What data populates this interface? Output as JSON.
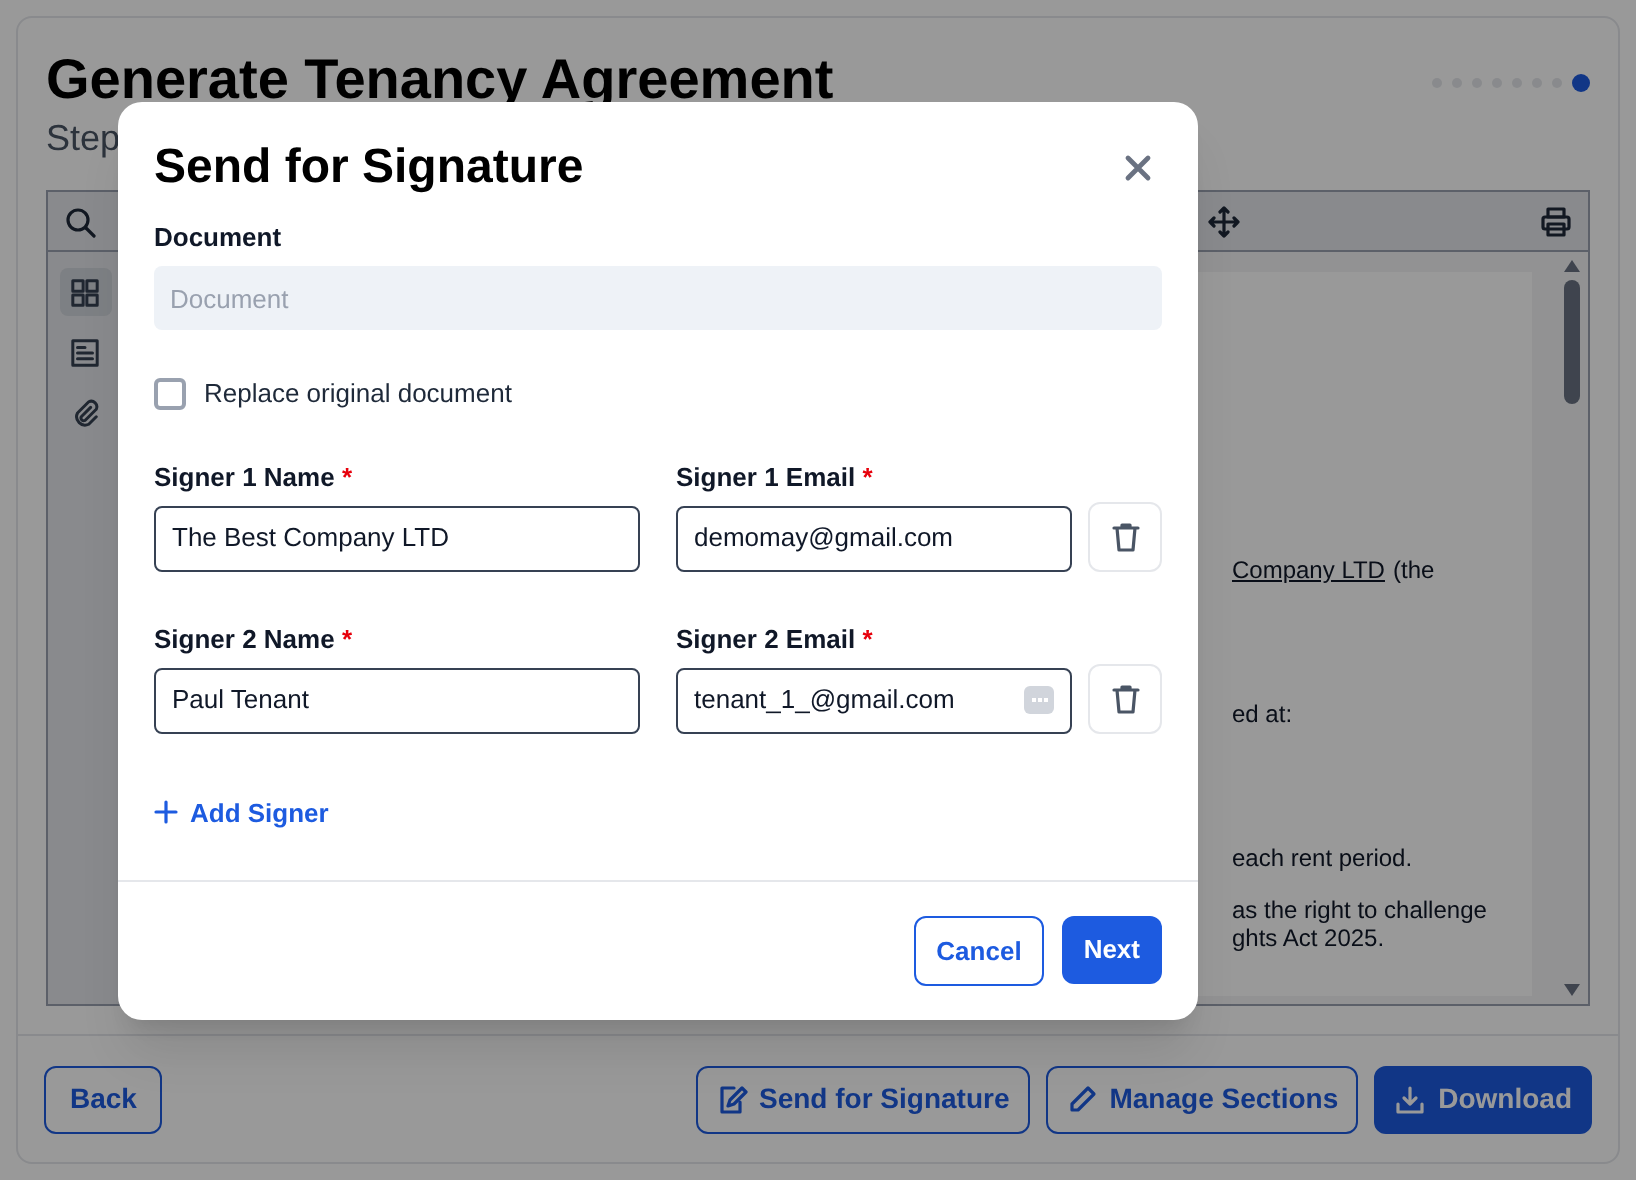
{
  "page": {
    "title": "Generate Tenancy Agreement",
    "subtitle": "Step"
  },
  "steps": [
    {
      "selected": false
    },
    {
      "selected": false
    },
    {
      "selected": false
    },
    {
      "selected": false
    },
    {
      "selected": false
    },
    {
      "selected": false
    },
    {
      "selected": false
    },
    {
      "selected": true
    }
  ],
  "viewer": {
    "sidebar": [
      {
        "kind": "thumbnails",
        "selected": true
      },
      {
        "kind": "outline",
        "selected": false
      },
      {
        "kind": "attachments",
        "selected": false
      }
    ],
    "lines": [
      {
        "parts": [
          {
            "text": "Company LTD",
            "underline": true
          },
          {
            "text": "(the",
            "underline": false
          }
        ]
      },
      {
        "parts": [
          {
            "text": "ed at:",
            "underline": false
          }
        ]
      },
      {
        "parts": [
          {
            "text": "each rent period.",
            "underline": false
          }
        ]
      },
      {
        "parts": [
          {
            "text": "as the right to challenge",
            "underline": false
          }
        ]
      },
      {
        "parts": [
          {
            "text": "ghts Act 2025.",
            "underline": false
          }
        ]
      }
    ]
  },
  "footer": {
    "back": "Back",
    "buttons": [
      {
        "kind": "sign",
        "label": "Send for Signature",
        "primary": false
      },
      {
        "kind": "edit",
        "label": "Manage Sections",
        "primary": false
      },
      {
        "kind": "download",
        "label": "Download",
        "primary": true
      }
    ]
  },
  "dialog": {
    "title": "Send for Signature",
    "document": {
      "label": "Document",
      "placeholder": "Document"
    },
    "replace": {
      "label": "Replace original document",
      "checked": false
    },
    "signers": [
      {
        "name_label": "Signer 1 Name",
        "name": "The Best Company LTD",
        "email_label": "Signer 1 Email",
        "email": "demomay@gmail.com",
        "autofill": false
      },
      {
        "name_label": "Signer 2 Name",
        "name": "Paul Tenant",
        "email_label": "Signer 2 Email",
        "email": "tenant_1_@gmail.com",
        "autofill": true
      }
    ],
    "required_mark": "*",
    "add": "Add Signer",
    "cancel": "Cancel",
    "next": "Next"
  }
}
